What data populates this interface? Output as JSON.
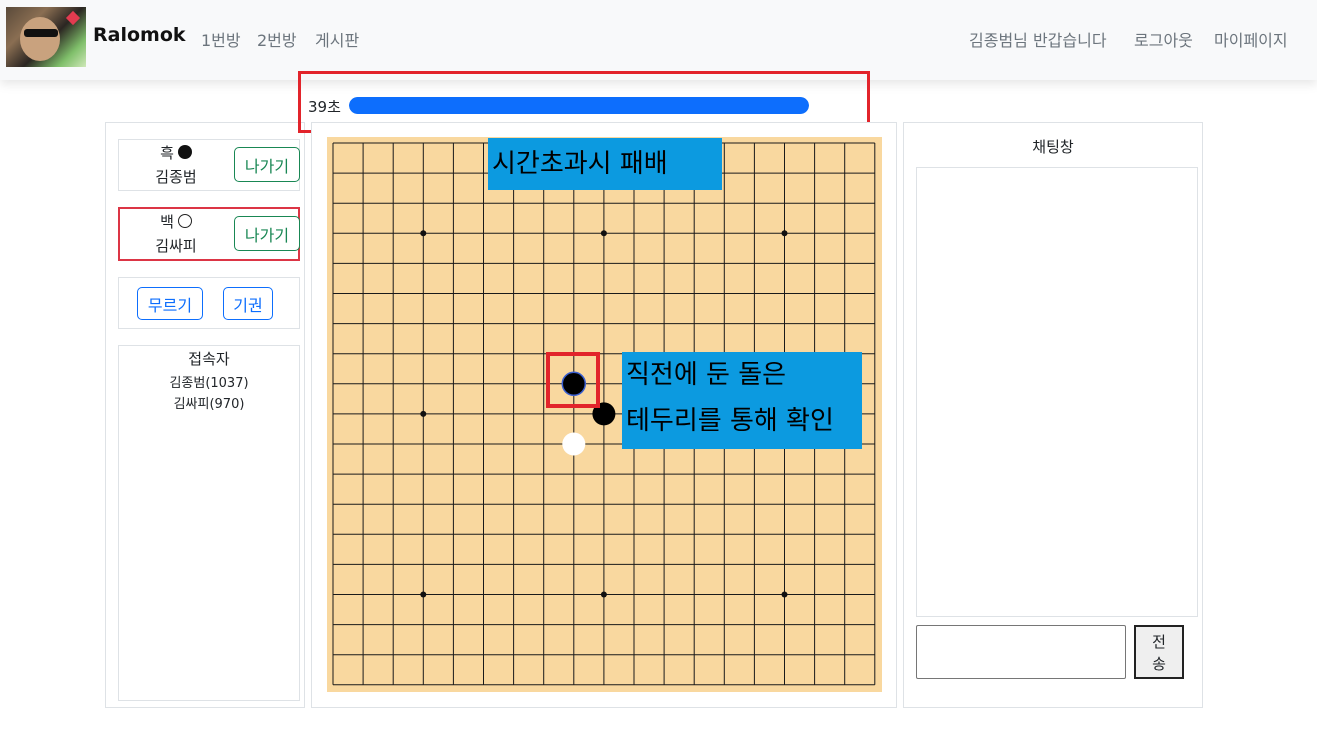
{
  "navbar": {
    "brand": "Ralomok",
    "links": [
      "1번방",
      "2번방",
      "게시판"
    ],
    "greeting": "김종범님 반갑습니다",
    "logout": "로그아웃",
    "mypage": "마이페이지"
  },
  "timer": {
    "label": "39초",
    "remaining_fraction": 1.0,
    "color": "#0d6efd"
  },
  "players": {
    "black": {
      "label": "흑",
      "name": "김종범",
      "exit": "나가기"
    },
    "white": {
      "label": "백",
      "name": "김싸피",
      "exit": "나가기"
    }
  },
  "actions": {
    "undo": "무르기",
    "resign": "기권"
  },
  "users": {
    "title": "접속자",
    "list": [
      "김종범(1037)",
      "김싸피(970)"
    ]
  },
  "board": {
    "size": 19,
    "star_points": [
      [
        3,
        3
      ],
      [
        3,
        9
      ],
      [
        3,
        15
      ],
      [
        9,
        3
      ],
      [
        9,
        15
      ],
      [
        15,
        3
      ],
      [
        15,
        9
      ],
      [
        15,
        15
      ]
    ],
    "stones": [
      {
        "row": 8,
        "col": 8,
        "color": "black",
        "last": true
      },
      {
        "row": 9,
        "col": 9,
        "color": "black",
        "last": false
      },
      {
        "row": 10,
        "col": 8,
        "color": "white",
        "last": false
      }
    ]
  },
  "annotations": {
    "timeout": "시간초과시 패배",
    "last_move_line1": "직전에 둔 돌은",
    "last_move_line2": "테두리를 통해 확인"
  },
  "chat": {
    "title": "채팅창",
    "send": "전\n송"
  },
  "colors": {
    "highlight": "#e2242b",
    "callout": "#0c9ae0",
    "board": "#f9d89f"
  }
}
